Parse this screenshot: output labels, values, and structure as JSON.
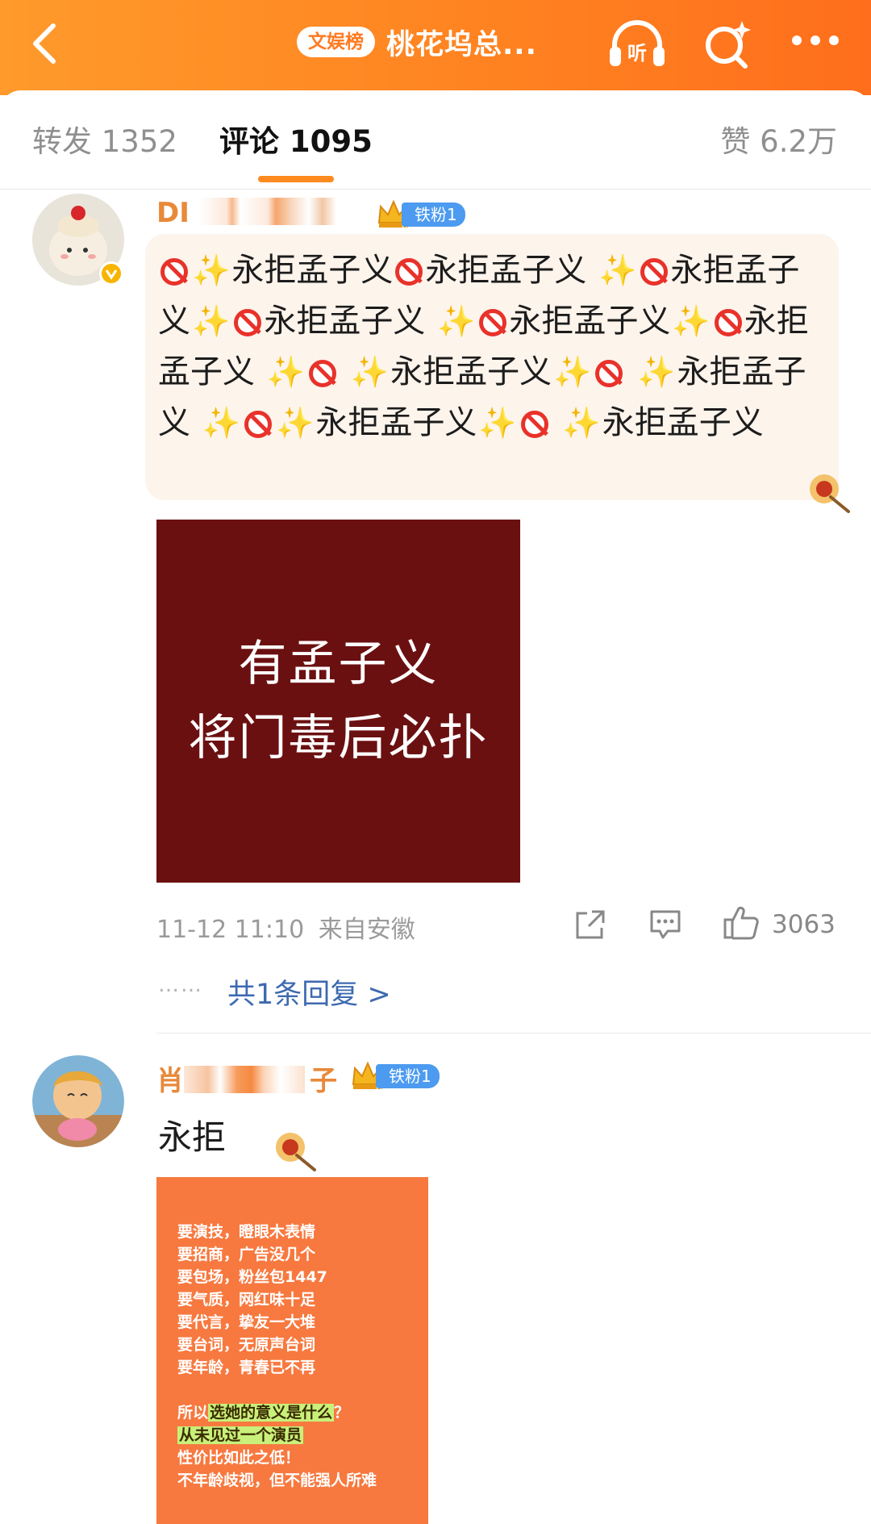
{
  "topbar": {
    "rank_badge": "文娱榜",
    "title": "桃花坞总..."
  },
  "tabs": {
    "repost": "转发 1352",
    "comment": "评论 1095",
    "like": "赞 6.2万"
  },
  "colors": {
    "header": "#ff8a24",
    "accent": "#ff8a20",
    "fan_badge": "#4c9bf0",
    "link": "#3d6ab0"
  },
  "comment1": {
    "username": "DI",
    "fan_label": "铁粉1",
    "fan_level": "6",
    "text_segments": [
      "永拒孟子义",
      "永拒孟子义",
      "永",
      "拒孟子义",
      "永拒孟子义",
      "永拒孟",
      "子义",
      "永拒孟子义",
      "永拒孟子",
      "义",
      "永拒孟子义",
      "永拒孟",
      "子义",
      "永拒孟子义"
    ],
    "image_line1": "有孟子义",
    "image_line2": "将门毒后必扑",
    "time": "11-12 11:10",
    "location": "来自安徽",
    "like_count": "3063",
    "reply_dots": "……",
    "reply_link": "共1条回复 >"
  },
  "comment2": {
    "username_start": "肖",
    "username_end": "子",
    "fan_label": "铁粉1",
    "fan_level": "6",
    "text": "永拒",
    "image": {
      "lines": [
        "要演技，瞪眼木表情",
        "要招商，广告没几个",
        "要包场，粉丝包1447",
        "要气质，网红味十足",
        "要代言，挚友一大堆",
        "要台词，无原声台词",
        "要年龄，青春已不再"
      ],
      "q_prefix": "所以",
      "q_highlight": "选她的意义是什么",
      "q_suffix": "？",
      "line_hl": "从未见过一个演员",
      "line_a": "性价比如此之低！",
      "line_b": "不年龄歧视，但不能强人所难"
    }
  }
}
